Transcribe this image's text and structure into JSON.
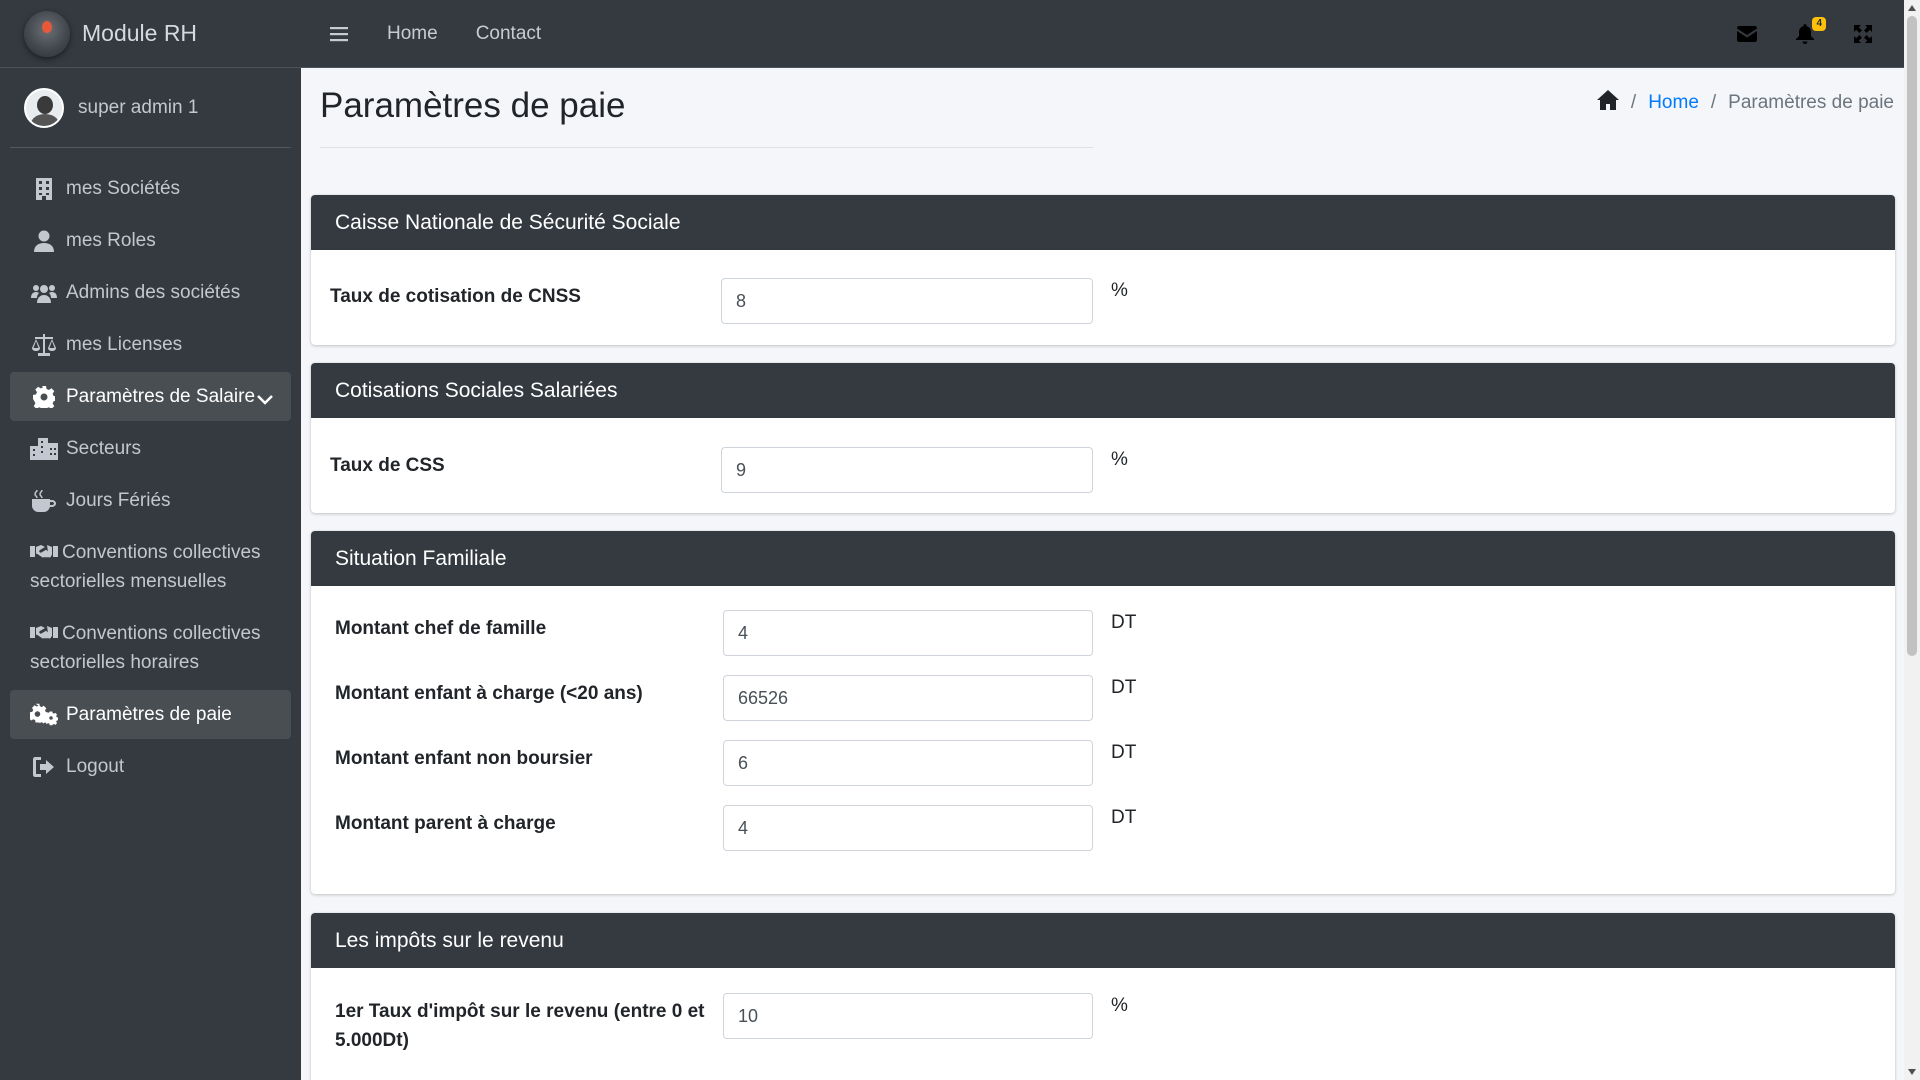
{
  "brand": {
    "title": "Module RH"
  },
  "user": {
    "name": "super admin 1"
  },
  "sidebar": {
    "items": [
      {
        "label": "mes Sociétés",
        "icon": "building-icon"
      },
      {
        "label": "mes Roles",
        "icon": "user-icon"
      },
      {
        "label": "Admins des sociétés",
        "icon": "users-icon"
      },
      {
        "label": "mes Licenses",
        "icon": "balance-scale-icon"
      },
      {
        "label": "Paramètres de Salaire",
        "icon": "gear-icon",
        "expanded": true
      },
      {
        "label": "Secteurs",
        "icon": "city-icon"
      },
      {
        "label": "Jours Fériés",
        "icon": "coffee-icon"
      },
      {
        "label_line1": "Conventions collectives",
        "label_line2": "sectorielles mensuelles",
        "icon": "handshake-icon"
      },
      {
        "label_line1": "Conventions collectives",
        "label_line2": "sectorielles horaires",
        "icon": "handshake-icon"
      },
      {
        "label": "Paramètres de paie",
        "icon": "gears-icon",
        "active": true
      },
      {
        "label": "Logout",
        "icon": "sign-out-icon"
      }
    ]
  },
  "topbar": {
    "links": [
      "Home",
      "Contact"
    ],
    "notification_count": "4"
  },
  "page": {
    "title": "Paramètres de paie",
    "breadcrumb": {
      "home": "Home",
      "current": "Paramètres de paie",
      "separator": "/"
    }
  },
  "sections": {
    "cnss": {
      "title": "Caisse Nationale de Sécurité Sociale",
      "fields": [
        {
          "label": "Taux de cotisation de CNSS",
          "value": "8",
          "unit": "%"
        }
      ]
    },
    "css": {
      "title": "Cotisations Sociales Salariées",
      "fields": [
        {
          "label": "Taux de CSS",
          "value": "9",
          "unit": "%"
        }
      ]
    },
    "famille": {
      "title": "Situation Familiale",
      "fields": [
        {
          "label": "Montant chef de famille",
          "value": "4",
          "unit": "DT"
        },
        {
          "label": "Montant enfant à charge (<20 ans)",
          "value": "66526",
          "unit": "DT"
        },
        {
          "label": "Montant enfant non boursier",
          "value": "6",
          "unit": "DT"
        },
        {
          "label": "Montant parent à charge",
          "value": "4",
          "unit": "DT"
        }
      ]
    },
    "impots": {
      "title": "Les impôts sur le revenu",
      "fields": [
        {
          "label_line1": "1er Taux d'impôt sur le revenu (entre 0 et",
          "label_line2": "5.000Dt)",
          "value": "10",
          "unit": "%"
        }
      ]
    }
  }
}
